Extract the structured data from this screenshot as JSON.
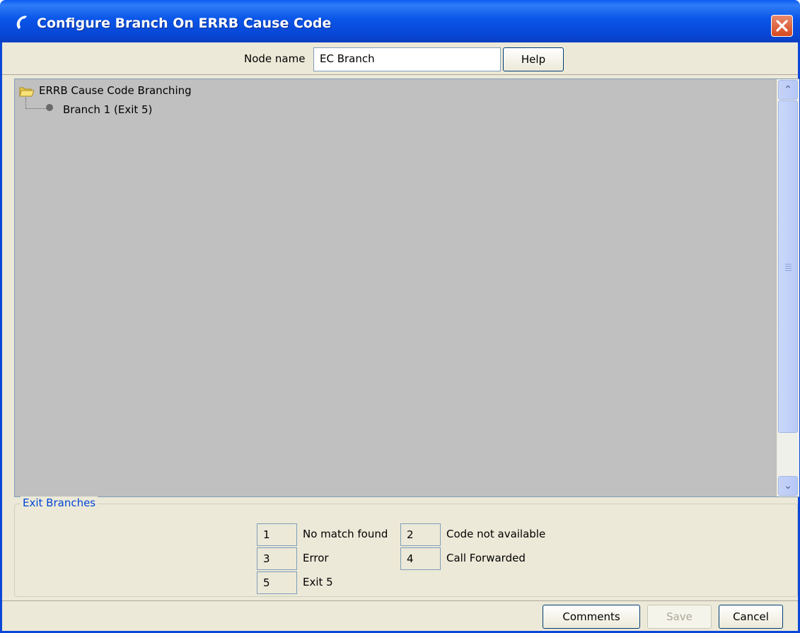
{
  "window": {
    "title": "Configure Branch On ERRB Cause Code",
    "icon": "phone-handset-icon",
    "close_icon": "close-x-icon"
  },
  "node": {
    "label": "Node name",
    "value": "EC Branch",
    "help_label": "Help"
  },
  "tree": {
    "root_label": "ERRB Cause Code Branching",
    "root_icon": "folder-open-icon",
    "items": [
      {
        "label": "Branch 1 (Exit 5)",
        "icon": "leaf-dot-icon"
      }
    ]
  },
  "scrollbar": {
    "up_glyph": "⌃",
    "down_glyph": "⌄"
  },
  "exits": {
    "title": "Exit Branches",
    "items": [
      {
        "number": "1",
        "label": "No match found"
      },
      {
        "number": "2",
        "label": "Code not available"
      },
      {
        "number": "3",
        "label": "Error"
      },
      {
        "number": "4",
        "label": "Call Forwarded"
      },
      {
        "number": "5",
        "label": "Exit 5"
      }
    ]
  },
  "footer": {
    "comments_label": "Comments",
    "save_label": "Save",
    "cancel_label": "Cancel"
  },
  "colors": {
    "title_bar": "#0a55e8",
    "panel_bg": "#ece9d8",
    "tree_bg": "#c0c0c0",
    "group_title": "#0046d5",
    "close_button": "#d5491e"
  }
}
